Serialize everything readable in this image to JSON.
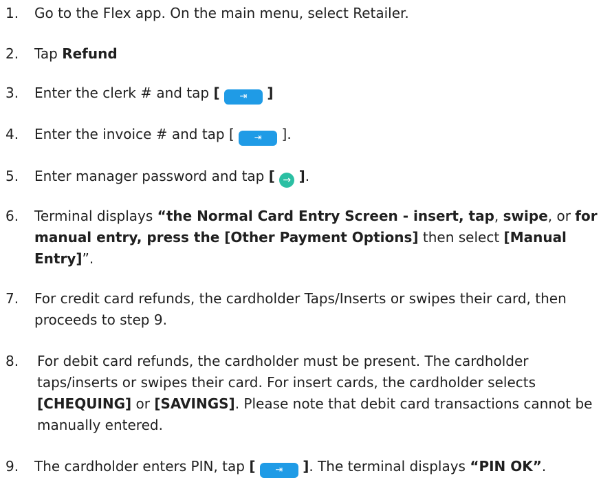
{
  "icons": {
    "enter_key": "enter-arrow-icon",
    "go_button": "circle-arrow-icon"
  },
  "colors": {
    "enter_key": "#1f9be6",
    "go_button": "#2bbfa3",
    "text": "#1f1f1f"
  },
  "steps": [
    {
      "num": "1.",
      "text": "Go to the Flex app. On the main menu, select Retailer."
    },
    {
      "num": "2.",
      "pre": "Tap ",
      "bold": "Refund"
    },
    {
      "num": "3.",
      "pre": "Enter the clerk # and tap ",
      "lb": "[",
      "rb": "]"
    },
    {
      "num": "4.",
      "pre": "Enter the invoice # and tap [",
      "post": "]."
    },
    {
      "num": "5.",
      "pre": "Enter manager password and tap ",
      "lb": "[",
      "rb": "]",
      "post": "."
    },
    {
      "num": "6.",
      "pre": "Terminal displays ",
      "b1": "“the Normal Card Entry Screen - insert, tap",
      "s1": ", ",
      "b2": "swipe",
      "s2": ", or ",
      "b3": "for manual entry,  press the [Other Payment Options]",
      "s3": " then select ",
      "b4": "[Manual Entry]",
      "s4": "”."
    },
    {
      "num": "7.",
      "text": "For credit card refunds, the cardholder Taps/Inserts or swipes their card, then proceeds to step 9."
    },
    {
      "num": "8.",
      "pre": "For debit card refunds, the cardholder must be present. The cardholder taps/inserts or swipes their card. For insert cards, the cardholder selects ",
      "b1": "[CHEQUING]",
      "s1": " or ",
      "b2": "[SAVINGS]",
      "s2": ". Please note that debit card transactions cannot be manually entered."
    },
    {
      "num": "9.",
      "pre": "The cardholder enters PIN, tap ",
      "lb": "[",
      "rb": "]",
      "mid": ".  The terminal displays ",
      "b1": "“PIN OK”",
      "post": "."
    }
  ]
}
